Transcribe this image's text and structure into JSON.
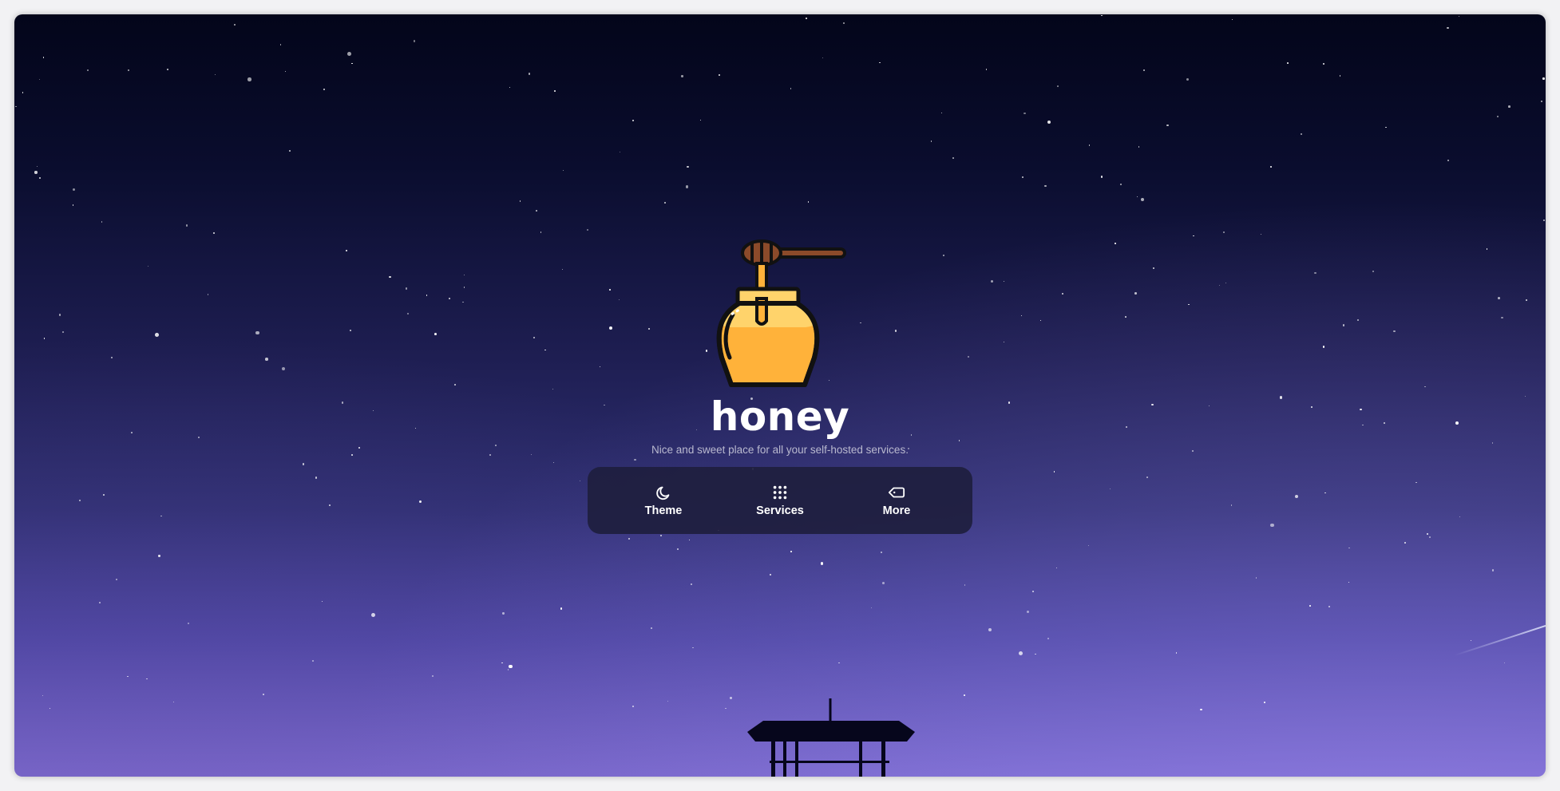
{
  "app": {
    "title": "honey",
    "tagline": "Nice and sweet place for all your self-hosted services."
  },
  "logo": {
    "icon": "honey-pot-icon",
    "colors": {
      "honey": "#ffb23a",
      "jar_top": "#ffd36b",
      "dipper": "#8b4a2a",
      "outline": "#111111"
    }
  },
  "nav": {
    "items": [
      {
        "label": "Theme",
        "icon": "moon-icon"
      },
      {
        "label": "Services",
        "icon": "grid-icon"
      },
      {
        "label": "More",
        "icon": "tag-icon"
      }
    ]
  },
  "background": {
    "description_icon": "night-sky",
    "colors": {
      "top": "#03051a",
      "mid": "#1e1e52",
      "bottom": "#7a6bd0"
    }
  }
}
